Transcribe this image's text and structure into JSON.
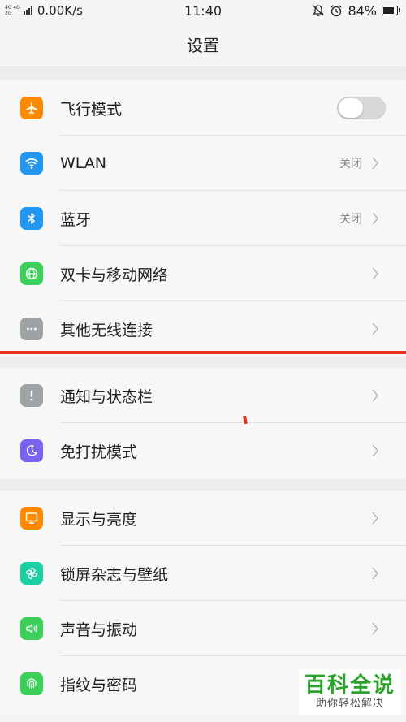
{
  "status_bar": {
    "network_top": "4G 4G",
    "network_bottom": "2G",
    "speed": "0.00K/s",
    "time": "11:40",
    "battery": "84%",
    "battery_level": 0.84
  },
  "page": {
    "title": "设置"
  },
  "groups": [
    {
      "items": [
        {
          "label": "飞行模式",
          "icon": "airplane-icon",
          "color": "#ff8a00",
          "toggle": false
        },
        {
          "label": "WLAN",
          "icon": "wifi-icon",
          "color": "#2196f3",
          "status": "关闭"
        },
        {
          "label": "蓝牙",
          "icon": "bluetooth-icon",
          "color": "#2196f3",
          "status": "关闭"
        },
        {
          "label": "双卡与移动网络",
          "icon": "globe-icon",
          "color": "#3ccf5a"
        },
        {
          "label": "其他无线连接",
          "icon": "more-dots-icon",
          "color": "#9ea3a8"
        }
      ]
    },
    {
      "items": [
        {
          "label": "通知与状态栏",
          "icon": "exclamation-icon",
          "color": "#9ea3a8"
        },
        {
          "label": "免打扰模式",
          "icon": "moon-icon",
          "color": "#7b63f2"
        }
      ]
    },
    {
      "items": [
        {
          "label": "显示与亮度",
          "icon": "monitor-icon",
          "color": "#ff8a00"
        },
        {
          "label": "锁屏杂志与壁纸",
          "icon": "pinwheel-icon",
          "color": "#1ccfa4"
        },
        {
          "label": "声音与振动",
          "icon": "speaker-icon",
          "color": "#3ccf5a"
        },
        {
          "label": "指纹与密码",
          "icon": "fingerprint-icon",
          "color": "#3ccf5a"
        }
      ]
    }
  ],
  "watermark": {
    "title": "百科全说",
    "subtitle": "助你轻松解决"
  }
}
